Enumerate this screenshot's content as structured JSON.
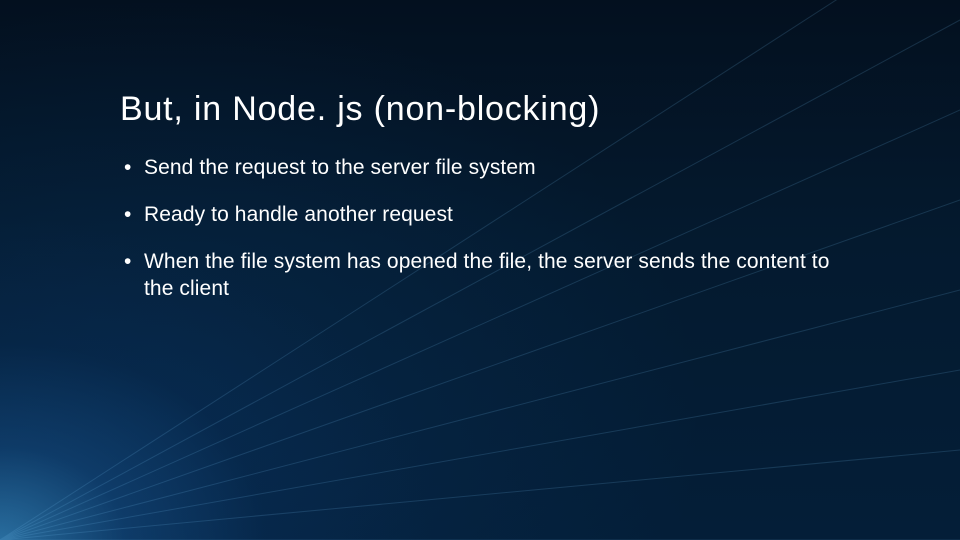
{
  "slide": {
    "title": "But, in Node. js (non-blocking)",
    "bullets": [
      "Send the request to the server file system",
      "Ready to handle another request",
      "When the file system has opened the file, the server sends the content to the client"
    ]
  }
}
